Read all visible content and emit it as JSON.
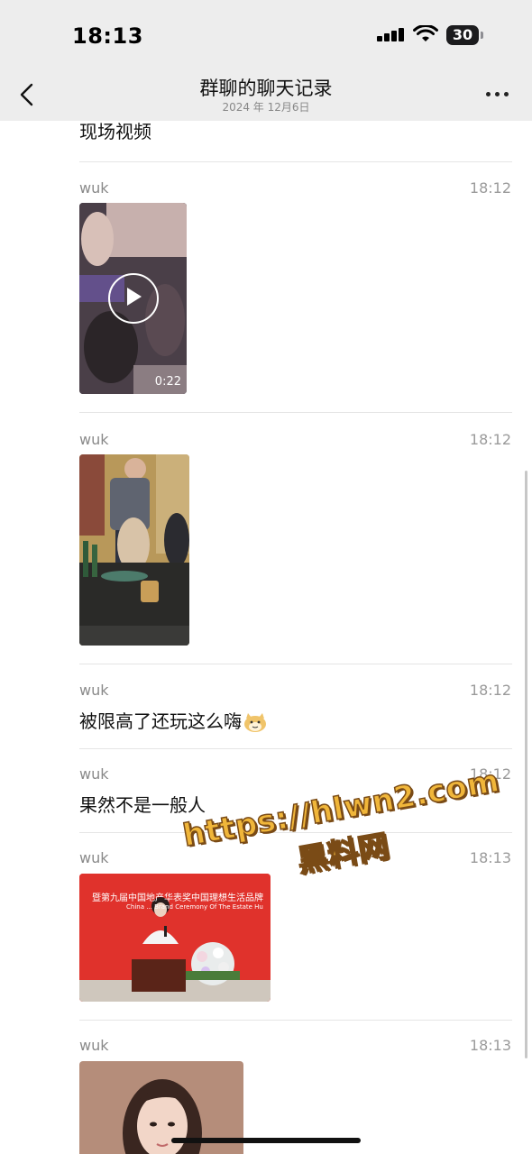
{
  "status": {
    "time": "18:13",
    "battery": "30"
  },
  "nav": {
    "title": "群聊的聊天记录",
    "subtitle": "2024 年 12月6日"
  },
  "messages": [
    {
      "text": "现场视频"
    },
    {
      "sender": "wuk",
      "time": "18:12",
      "type": "video",
      "duration": "0:22"
    },
    {
      "sender": "wuk",
      "time": "18:12",
      "type": "image"
    },
    {
      "sender": "wuk",
      "time": "18:12",
      "type": "text",
      "text": "被限高了还玩这么嗨"
    },
    {
      "sender": "wuk",
      "time": "18:12",
      "type": "text",
      "text": "果然不是一般人"
    },
    {
      "sender": "wuk",
      "time": "18:13",
      "type": "image",
      "banner_text": "暨第九届中国地产华表奖中国理想生活品牌",
      "banner_en": "China ... Brand Ceremony Of The Estate Hu"
    },
    {
      "sender": "wuk",
      "time": "18:13",
      "type": "image"
    }
  ],
  "watermark": {
    "url": "https://hlwn2.com",
    "name": "黑料网"
  },
  "colors": {
    "bar_bg": "#ededed",
    "text": "#111111",
    "meta": "#8a8a8a",
    "red_banner": "#e0322c"
  },
  "icons": [
    "back-chevron-icon",
    "more-dots-icon",
    "play-icon",
    "signal-icon",
    "wifi-icon",
    "battery-icon",
    "cat-emoji-icon"
  ]
}
